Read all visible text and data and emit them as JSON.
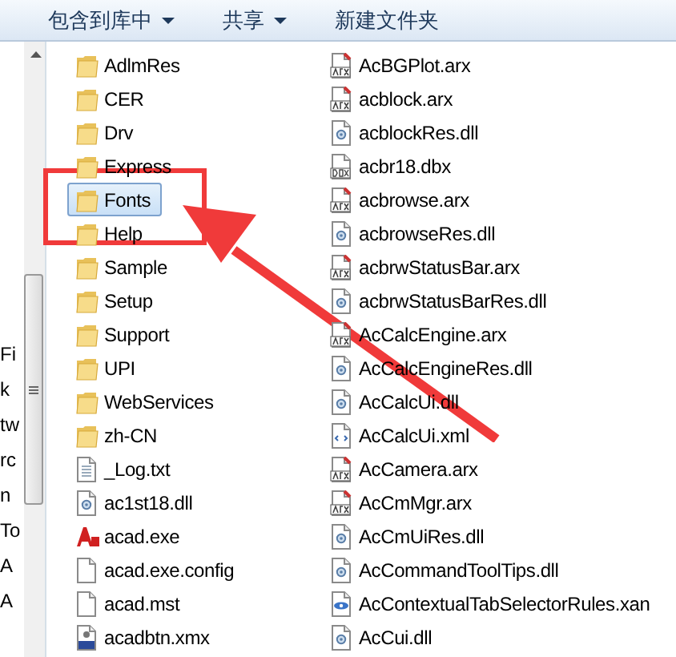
{
  "toolbar": [
    {
      "label": "包含到库中",
      "dropdown": true
    },
    {
      "label": "共享",
      "dropdown": true
    },
    {
      "label": "新建文件夹",
      "dropdown": false
    }
  ],
  "nav_pane": {
    "cut_labels": [
      "Fi",
      "k",
      "tw",
      "rc",
      "n",
      "To",
      "A",
      "A"
    ]
  },
  "columns": [
    [
      {
        "name": "AdlmRes",
        "kind": "folder",
        "selected": false
      },
      {
        "name": "CER",
        "kind": "folder",
        "selected": false
      },
      {
        "name": "Drv",
        "kind": "folder",
        "selected": false
      },
      {
        "name": "Express",
        "kind": "folder",
        "selected": false
      },
      {
        "name": "Fonts",
        "kind": "folder",
        "selected": true
      },
      {
        "name": "Help",
        "kind": "folder",
        "selected": false
      },
      {
        "name": "Sample",
        "kind": "folder",
        "selected": false
      },
      {
        "name": "Setup",
        "kind": "folder",
        "selected": false
      },
      {
        "name": "Support",
        "kind": "folder",
        "selected": false
      },
      {
        "name": "UPI",
        "kind": "folder",
        "selected": false
      },
      {
        "name": "WebServices",
        "kind": "folder",
        "selected": false
      },
      {
        "name": "zh-CN",
        "kind": "folder",
        "selected": false
      },
      {
        "name": "_Log.txt",
        "kind": "text",
        "selected": false
      },
      {
        "name": "ac1st18.dll",
        "kind": "dll",
        "selected": false
      },
      {
        "name": "acad.exe",
        "kind": "exe",
        "selected": false
      },
      {
        "name": "acad.exe.config",
        "kind": "blank",
        "selected": false
      },
      {
        "name": "acad.mst",
        "kind": "blank",
        "selected": false
      },
      {
        "name": "acadbtn.xmx",
        "kind": "xmx",
        "selected": false
      }
    ],
    [
      {
        "name": "AcBGPlot.arx",
        "kind": "arx",
        "selected": false
      },
      {
        "name": "acblock.arx",
        "kind": "arx",
        "selected": false
      },
      {
        "name": "acblockRes.dll",
        "kind": "dll",
        "selected": false
      },
      {
        "name": "acbr18.dbx",
        "kind": "dbx",
        "selected": false
      },
      {
        "name": "acbrowse.arx",
        "kind": "arx",
        "selected": false
      },
      {
        "name": "acbrowseRes.dll",
        "kind": "dll",
        "selected": false
      },
      {
        "name": "acbrwStatusBar.arx",
        "kind": "arx",
        "selected": false
      },
      {
        "name": "acbrwStatusBarRes.dll",
        "kind": "dll",
        "selected": false
      },
      {
        "name": "AcCalcEngine.arx",
        "kind": "arx",
        "selected": false
      },
      {
        "name": "AcCalcEngineRes.dll",
        "kind": "dll",
        "selected": false
      },
      {
        "name": "AcCalcUi.dll",
        "kind": "dll",
        "selected": false
      },
      {
        "name": "AcCalcUi.xml",
        "kind": "xml",
        "selected": false
      },
      {
        "name": "AcCamera.arx",
        "kind": "arx",
        "selected": false
      },
      {
        "name": "AcCmMgr.arx",
        "kind": "arx",
        "selected": false
      },
      {
        "name": "AcCmUiRes.dll",
        "kind": "dll",
        "selected": false
      },
      {
        "name": "AcCommandToolTips.dll",
        "kind": "dll",
        "selected": false
      },
      {
        "name": "AcContextualTabSelectorRules.xan",
        "kind": "xaml",
        "selected": false
      },
      {
        "name": "AcCui.dll",
        "kind": "dll",
        "selected": false
      }
    ]
  ]
}
